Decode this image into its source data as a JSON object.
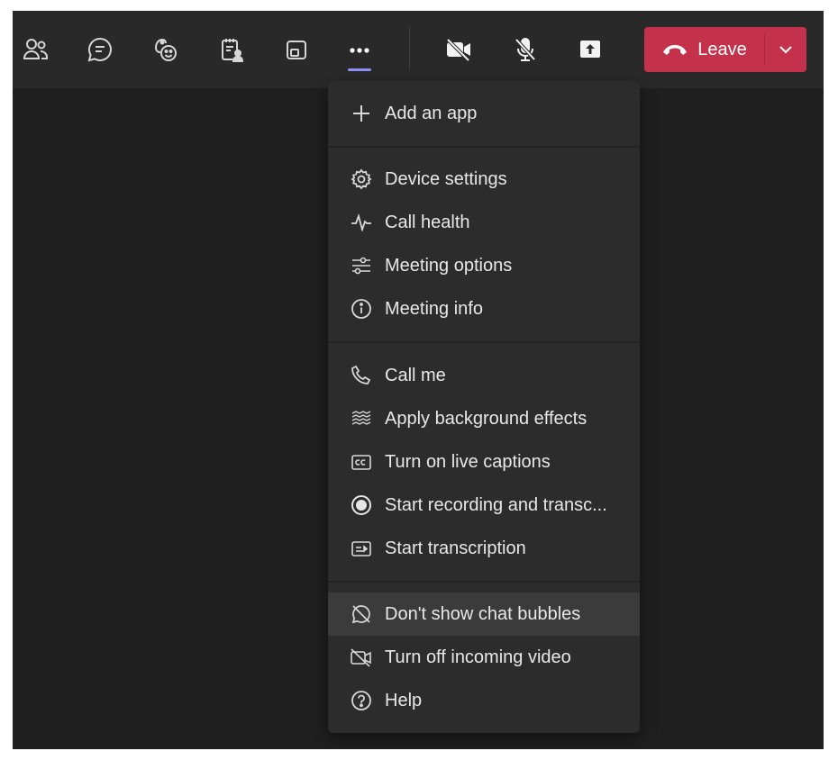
{
  "toolbar": {
    "buttons": [
      {
        "name": "people-icon"
      },
      {
        "name": "chat-icon"
      },
      {
        "name": "react-icon"
      },
      {
        "name": "notes-icon"
      },
      {
        "name": "share-tray-icon"
      },
      {
        "name": "more-options-icon",
        "active": true
      },
      {
        "name": "camera-off-icon"
      },
      {
        "name": "mic-off-icon"
      },
      {
        "name": "share-screen-icon"
      }
    ],
    "leave_label": "Leave",
    "leave_color": "#c4314b",
    "active_indicator_color": "#8f8ff5"
  },
  "menu": {
    "items": [
      {
        "label": "Add an app",
        "icon": "plus-icon"
      },
      {
        "label": "Device settings",
        "icon": "gear-icon"
      },
      {
        "label": "Call health",
        "icon": "pulse-icon"
      },
      {
        "label": "Meeting options",
        "icon": "sliders-icon"
      },
      {
        "label": "Meeting info",
        "icon": "info-icon"
      },
      {
        "label": "Call me",
        "icon": "phone-icon"
      },
      {
        "label": "Apply background effects",
        "icon": "background-effects-icon"
      },
      {
        "label": "Turn on live captions",
        "icon": "captions-icon"
      },
      {
        "label": "Start recording and transc...",
        "icon": "record-icon"
      },
      {
        "label": "Start transcription",
        "icon": "transcription-icon"
      },
      {
        "label": "Don't show chat bubbles",
        "icon": "chat-bubble-off-icon",
        "highlighted": true
      },
      {
        "label": "Turn off incoming video",
        "icon": "video-off-icon"
      },
      {
        "label": "Help",
        "icon": "help-icon"
      }
    ]
  }
}
